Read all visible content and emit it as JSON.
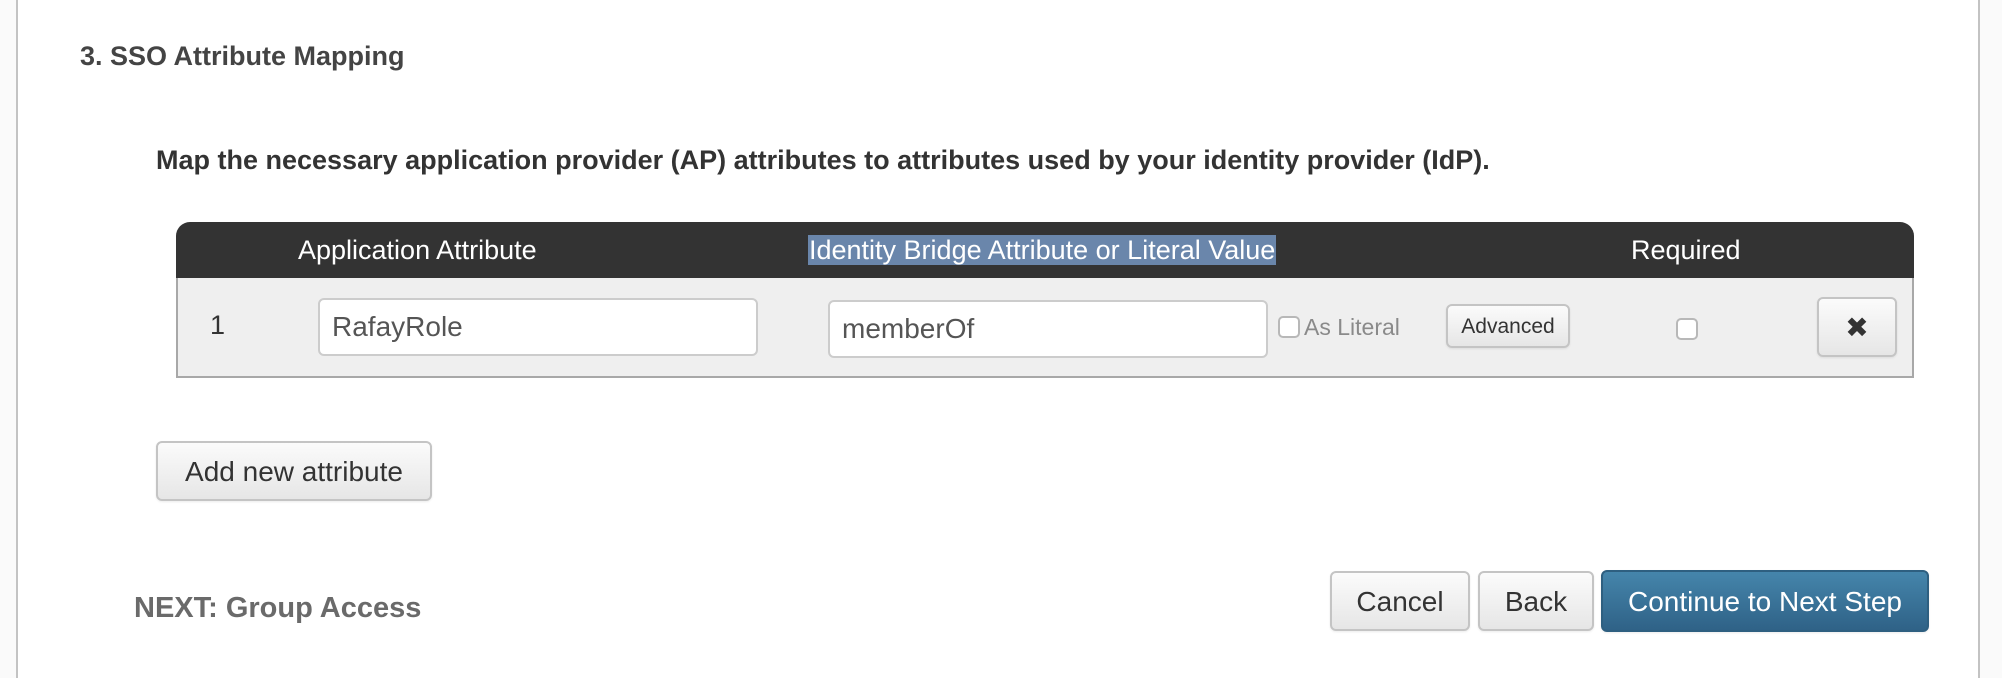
{
  "section": {
    "title": "3. SSO Attribute Mapping",
    "instructions": "Map the necessary application provider (AP) attributes to attributes used by your identity provider (IdP)."
  },
  "table": {
    "headers": {
      "application_attribute": "Application Attribute",
      "identity_bridge_attribute": "Identity Bridge Attribute or Literal Value",
      "required": "Required"
    },
    "rows": [
      {
        "index": "1",
        "application_attribute": "RafayRole",
        "identity_bridge_attribute": "memberOf",
        "as_literal_label": "As Literal",
        "as_literal_checked": false,
        "advanced_label": "Advanced",
        "required_checked": false,
        "remove_icon": "close-icon"
      }
    ]
  },
  "actions": {
    "add_attribute_label": "Add new attribute",
    "next_label": "NEXT: Group Access",
    "cancel_label": "Cancel",
    "back_label": "Back",
    "continue_label": "Continue to Next Step"
  },
  "colors": {
    "header_background": "#333333",
    "selection_highlight": "#6a86ab",
    "primary_button": "#336b91"
  }
}
